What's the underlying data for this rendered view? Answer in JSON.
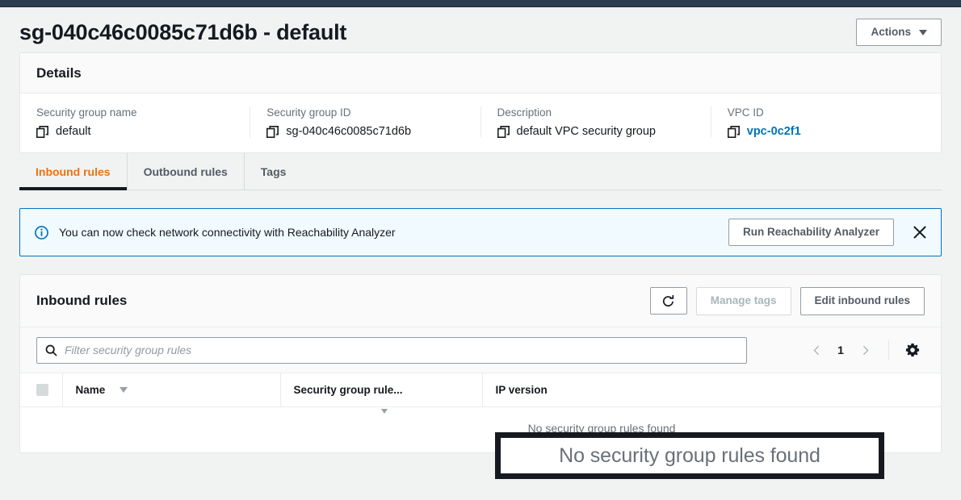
{
  "header": {
    "title": "sg-040c46c0085c71d6b - default",
    "actions_label": "Actions"
  },
  "details": {
    "panel_title": "Details",
    "fields": [
      {
        "label": "Security group name",
        "value": "default",
        "is_link": false
      },
      {
        "label": "Security group ID",
        "value": "sg-040c46c0085c71d6b",
        "is_link": false
      },
      {
        "label": "Description",
        "value": "default VPC security group",
        "is_link": false
      },
      {
        "label": "VPC ID",
        "value": "vpc-0c2f1",
        "is_link": true
      }
    ]
  },
  "tabs": [
    {
      "label": "Inbound rules",
      "active": true
    },
    {
      "label": "Outbound rules",
      "active": false
    },
    {
      "label": "Tags",
      "active": false
    }
  ],
  "banner": {
    "icon": "info-circle-icon",
    "text": "You can now check network connectivity with Reachability Analyzer",
    "button_label": "Run Reachability Analyzer",
    "close_icon": "close-icon"
  },
  "rules_panel": {
    "title": "Inbound rules",
    "refresh_icon": "refresh-icon",
    "manage_tags_label": "Manage tags",
    "manage_tags_disabled": true,
    "edit_rules_label": "Edit inbound rules",
    "search": {
      "icon": "search-icon",
      "placeholder": "Filter security group rules",
      "value": ""
    },
    "pagination": {
      "prev_icon": "chevron-left-icon",
      "page": "1",
      "next_icon": "chevron-right-icon",
      "settings_icon": "gear-icon"
    },
    "table": {
      "columns": [
        {
          "label": "Name",
          "sortable": true
        },
        {
          "label": "Security group rule...",
          "sortable": true
        },
        {
          "label": "IP version",
          "sortable": false
        }
      ],
      "rows": [],
      "empty_text": "No security group rules found"
    }
  },
  "highlight": {
    "text": "No security group rules found"
  },
  "colors": {
    "accent_orange": "#ec7211",
    "link_blue": "#0073bb",
    "nav_dark": "#2d3e50",
    "banner_bg": "#f1faff"
  }
}
